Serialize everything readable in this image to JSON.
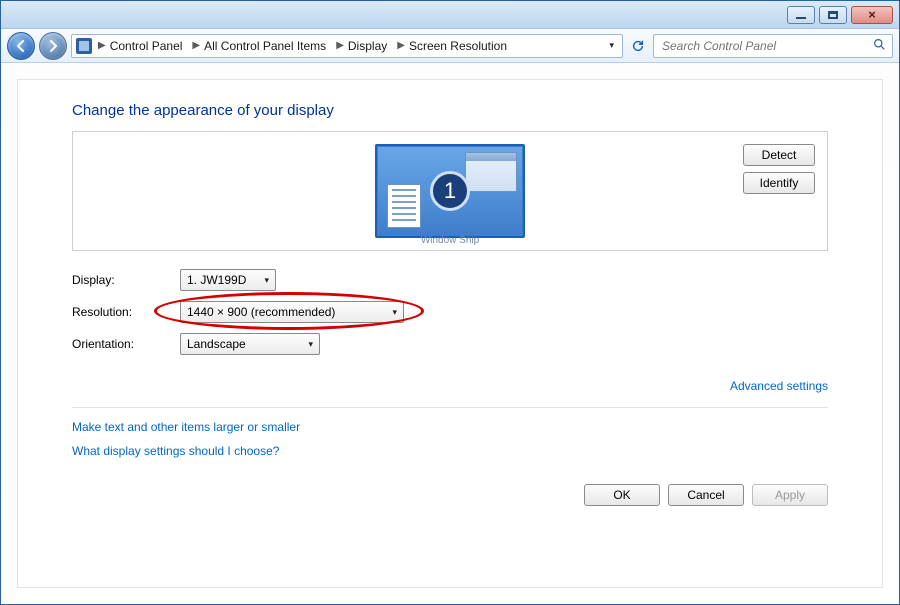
{
  "titlebar": {
    "min_tip": "Minimize",
    "max_tip": "Maximize",
    "close_tip": "Close"
  },
  "breadcrumbs": {
    "items": [
      "Control Panel",
      "All Control Panel Items",
      "Display",
      "Screen Resolution"
    ]
  },
  "search": {
    "placeholder": "Search Control Panel"
  },
  "page": {
    "title": "Change the appearance of your display",
    "monitor_number": "1",
    "watermark": "Window Snip"
  },
  "buttons": {
    "detect": "Detect",
    "identify": "Identify",
    "ok": "OK",
    "cancel": "Cancel",
    "apply": "Apply"
  },
  "form": {
    "display_label": "Display:",
    "display_value": "1. JW199D",
    "resolution_label": "Resolution:",
    "resolution_value": "1440 × 900 (recommended)",
    "orientation_label": "Orientation:",
    "orientation_value": "Landscape"
  },
  "links": {
    "advanced": "Advanced settings",
    "larger_text": "Make text and other items larger or smaller",
    "help": "What display settings should I choose?"
  }
}
